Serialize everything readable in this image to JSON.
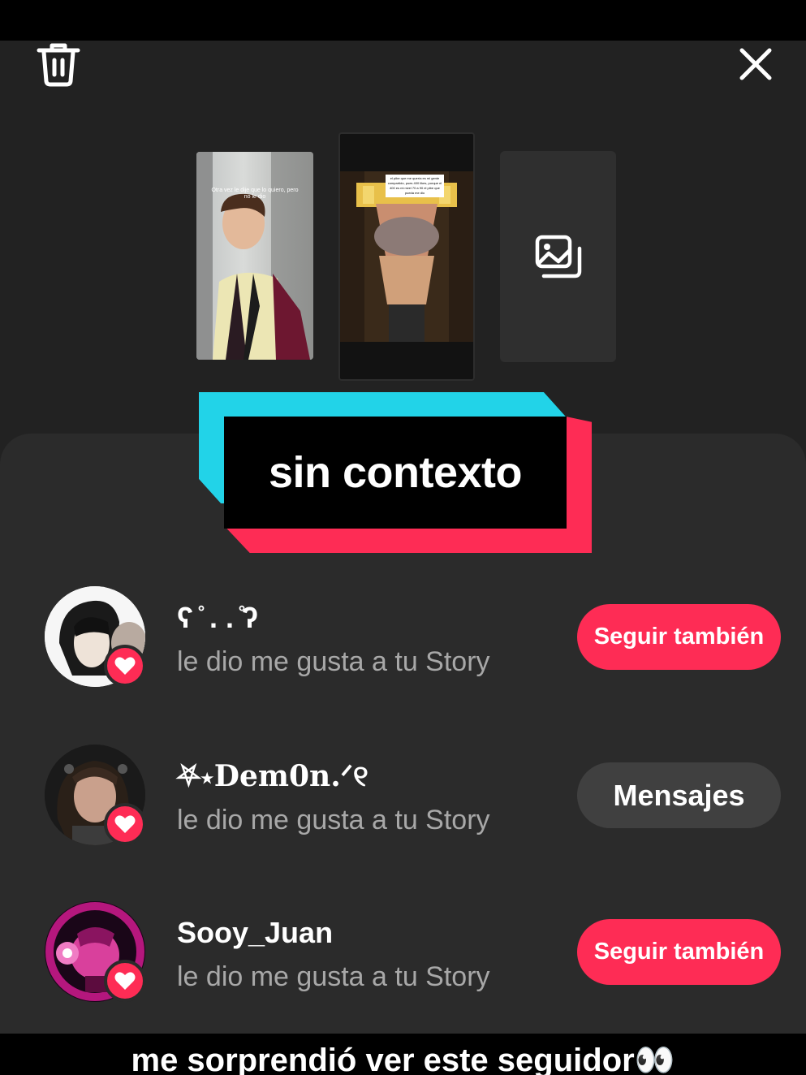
{
  "story_viewer": {
    "delete_icon": "trash-icon",
    "close_icon": "close-icon",
    "add_media_icon": "gallery-icon",
    "thumbnail_1_caption": "Otra vez le dije que lo quiero, pero no le dio",
    "thumbnail_2_caption": "el pibe que me quería es mi gente compartido, pues 400 likes, porque el 400 es mi nivel 70 a 90 el pibe que pueda me dio"
  },
  "overlay_tag": {
    "text": "sin contexto"
  },
  "activity": [
    {
      "name": "ʕ ̊ . . ̊ʔ",
      "subtitle": "le dio me gusta a tu Story",
      "button": "Seguir también",
      "button_style": "primary"
    },
    {
      "name": "⛧⋆Dem0n.ᐟ୧",
      "subtitle": "le dio me gusta a tu Story",
      "button": "Mensajes",
      "button_style": "secondary"
    },
    {
      "name": "Sooy_Juan",
      "subtitle": "le dio me gusta a tu Story",
      "button": "Seguir también",
      "button_style": "primary"
    }
  ],
  "caption": "me sorprendió ver este seguidor👀",
  "colors": {
    "accent_red": "#fe2c55",
    "accent_cyan": "#22d3e8",
    "sheet_bg": "#2b2b2b"
  }
}
